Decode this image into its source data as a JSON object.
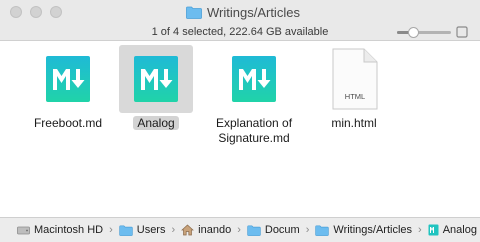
{
  "window": {
    "title": "Writings/Articles"
  },
  "status": {
    "text": "1 of 4 selected, 222.64 GB available",
    "zoom_level": 0.3
  },
  "files": [
    {
      "name": "Freeboot.md",
      "kind": "markdown",
      "selected": false
    },
    {
      "name": "Analog",
      "kind": "markdown",
      "selected": true
    },
    {
      "name": "Explanation of Signature.md",
      "kind": "markdown",
      "selected": false
    },
    {
      "name": "min.html",
      "kind": "html",
      "selected": false
    }
  ],
  "html_badge": "HTML",
  "path": [
    {
      "label": "Macintosh HD",
      "icon": "hard-drive-icon"
    },
    {
      "label": "Users",
      "icon": "folder-icon"
    },
    {
      "label": "inando",
      "icon": "home-icon"
    },
    {
      "label": "Docum",
      "icon": "folder-icon"
    },
    {
      "label": "Writings/Articles",
      "icon": "folder-icon"
    },
    {
      "label": "Analog",
      "icon": "markdown-file-icon"
    }
  ],
  "colors": {
    "markdown_icon_top": "#1fbad6",
    "markdown_icon_bottom": "#20d3a9",
    "folder": "#5fb3e8",
    "selection": "#d9d9d9"
  }
}
